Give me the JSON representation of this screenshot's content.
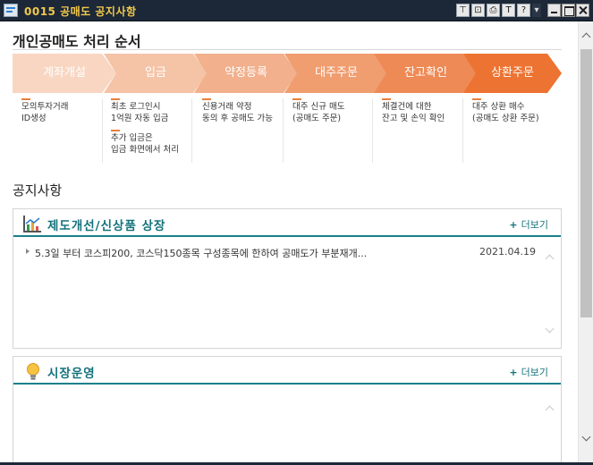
{
  "window": {
    "title": "0015 공매도 공지사항"
  },
  "toolbar": {
    "buttons": [
      {
        "name": "pin-icon",
        "glyph": "⊤"
      },
      {
        "name": "link-icon",
        "glyph": "⊡"
      },
      {
        "name": "print-icon",
        "glyph": "⎙"
      },
      {
        "name": "font-icon",
        "glyph": "T"
      },
      {
        "name": "help-icon",
        "glyph": "?"
      },
      {
        "name": "menu-icon",
        "glyph": "▾"
      }
    ]
  },
  "process": {
    "title": "개인공매도 처리 순서",
    "steps": [
      {
        "label": "계좌개설",
        "color": "#f8d6c2",
        "desc": [
          [
            "모의투자거래",
            "ID생성"
          ]
        ]
      },
      {
        "label": "입금",
        "color": "#f5c3a6",
        "desc": [
          [
            "최초 로그인시",
            "1억원 자동 입금"
          ],
          [
            "추가 입금은",
            "입금 화면에서 처리"
          ]
        ]
      },
      {
        "label": "약정등록",
        "color": "#f2b08d",
        "desc": [
          [
            "신용거래 약정",
            "동의 후 공매도 가능"
          ]
        ]
      },
      {
        "label": "대주주문",
        "color": "#f09d70",
        "desc": [
          [
            "대주 신규 매도",
            "(공매도 주문)"
          ]
        ]
      },
      {
        "label": "잔고확인",
        "color": "#ee8a56",
        "desc": [
          [
            "체결건에 대한",
            "잔고 및 손익 확인"
          ]
        ]
      },
      {
        "label": "상환주문",
        "color": "#ed7332",
        "desc": [
          [
            "대주 상환 매수",
            "(공매도 상환 주문)"
          ]
        ]
      }
    ]
  },
  "notice": {
    "title": "공지사항",
    "panels": [
      {
        "title": "제도개선/신상품 상장",
        "icon": "chart-icon",
        "more": "더보기",
        "rows": [
          {
            "text": "5.3일 부터 코스피200, 코스닥150종목 구성종목에 한하여 공매도가 부분재개...",
            "date": "2021.04.19"
          }
        ]
      },
      {
        "title": "시장운영",
        "icon": "lightbulb-icon",
        "more": "더보기",
        "rows": []
      }
    ]
  }
}
